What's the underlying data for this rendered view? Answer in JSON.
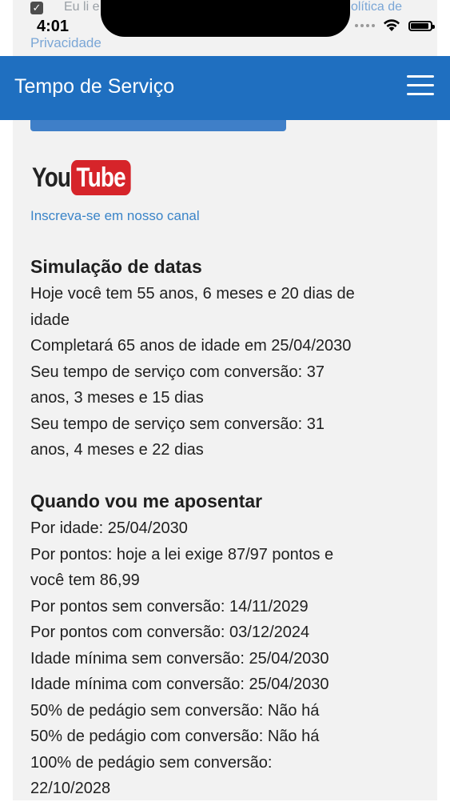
{
  "status_bar": {
    "time": "4:01"
  },
  "behind": {
    "terms_left": "Eu li e",
    "terms_right": "olítica de",
    "privacy": "Privacidade"
  },
  "header": {
    "title": "Tempo de Serviço"
  },
  "youtube": {
    "logo_you": "You",
    "logo_tube": "Tube",
    "subscribe": "Inscreva-se em nosso canal"
  },
  "simulation": {
    "title": "Simulação de datas",
    "lines": [
      "Hoje você tem 55 anos, 6 meses e 20 dias de",
      "idade",
      "Completará 65 anos de idade em 25/04/2030",
      "Seu tempo de serviço com conversão: 37",
      "anos, 3 meses e 15 dias",
      "Seu tempo de serviço sem conversão: 31",
      "anos, 4 meses e 22 dias"
    ]
  },
  "retirement": {
    "title": "Quando vou me aposentar",
    "lines": [
      "Por idade: 25/04/2030",
      "Por pontos: hoje a lei exige 87/97 pontos e",
      "você tem 86,99",
      "Por pontos sem conversão: 14/11/2029",
      "Por pontos com conversão: 03/12/2024",
      "Idade mínima sem conversão: 25/04/2030",
      "Idade mínima com conversão: 25/04/2030",
      "50% de pedágio sem conversão: Não há",
      "50% de pedágio com conversão: Não há",
      "100% de pedágio sem conversão:",
      "22/10/2028"
    ]
  },
  "colors": {
    "app_bar": "#1f6fc0",
    "link": "#3a84c8",
    "youtube_red": "#d6242a"
  }
}
